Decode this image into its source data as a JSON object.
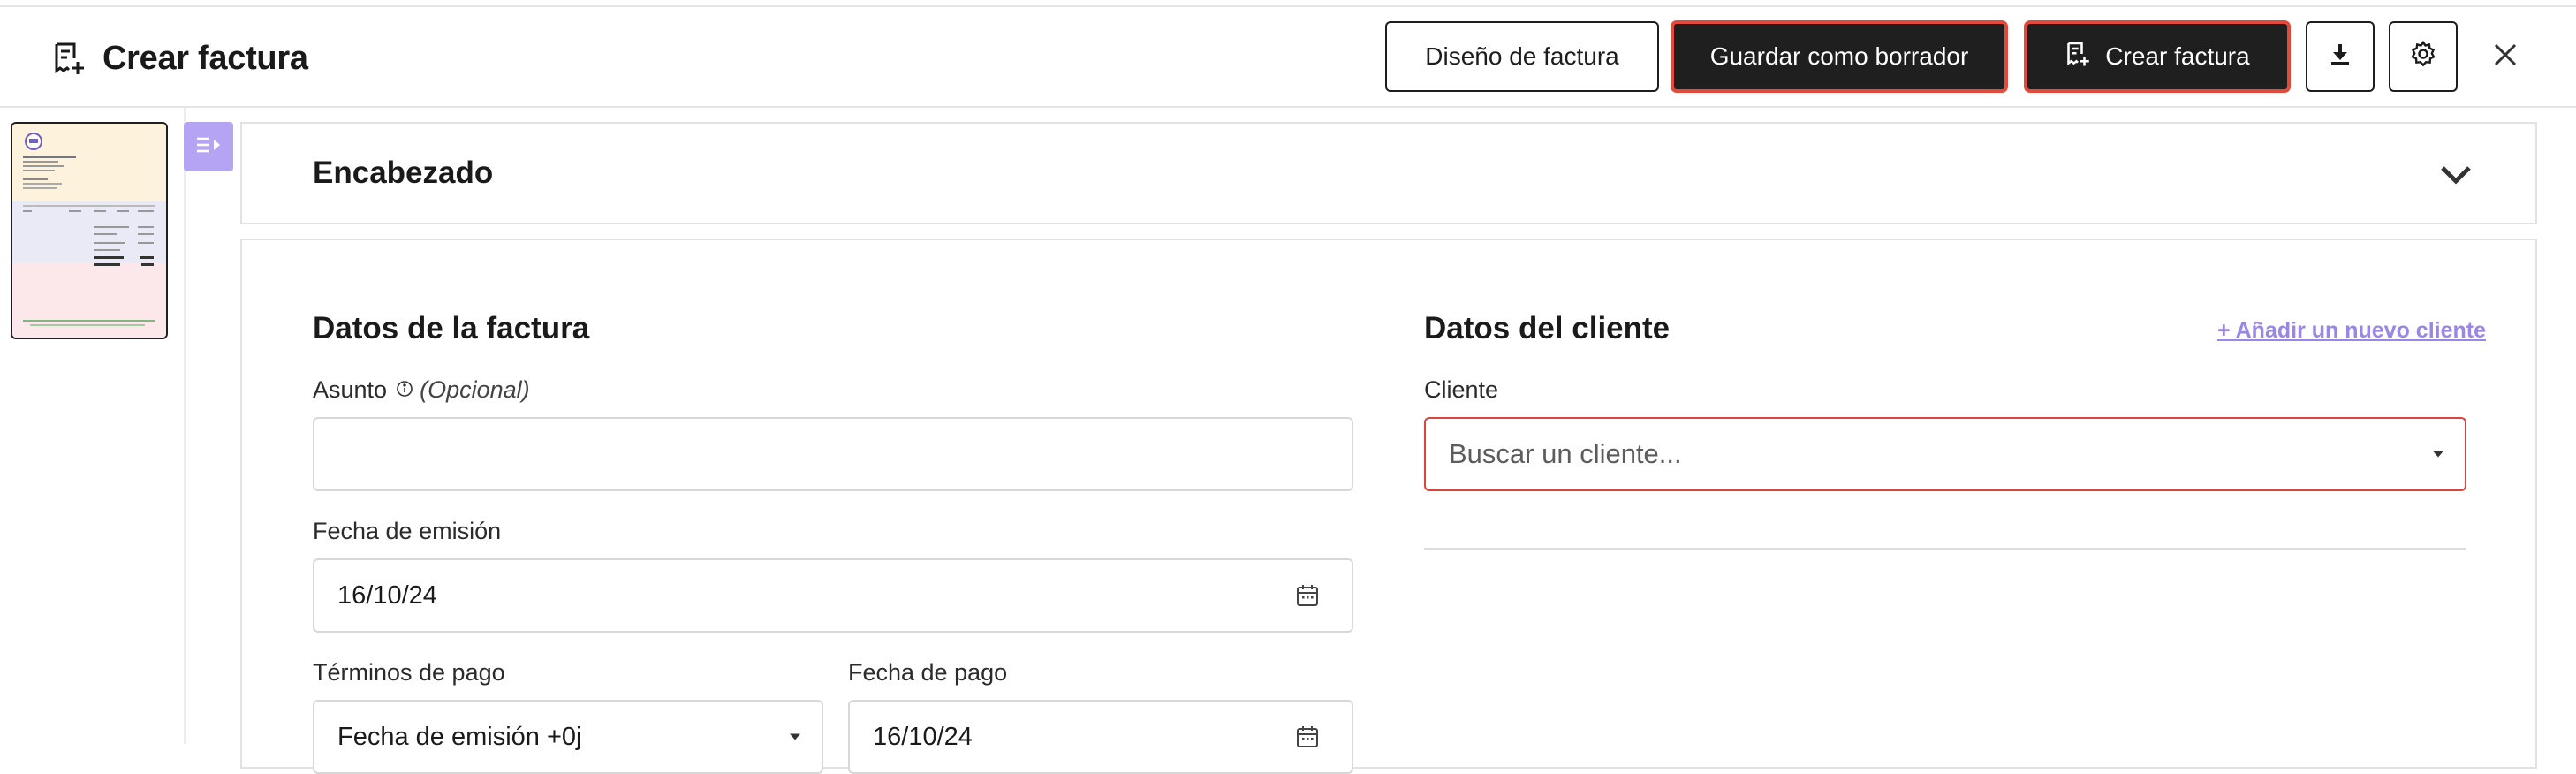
{
  "header": {
    "title": "Crear factura",
    "design_label": "Diseño de factura",
    "draft_label": "Guardar como borrador",
    "create_label": "Crear factura"
  },
  "sections": {
    "header_title": "Encabezado",
    "invoice_data_title": "Datos de la factura",
    "client_data_title": "Datos del cliente"
  },
  "invoice": {
    "subject_label": "Asunto",
    "subject_optional": "(Opcional)",
    "subject_value": "",
    "issue_date_label": "Fecha de emisión",
    "issue_date_value": "16/10/24",
    "payment_terms_label": "Términos de pago",
    "payment_terms_value": "Fecha de emisión +0j",
    "payment_date_label": "Fecha de pago",
    "payment_date_value": "16/10/24"
  },
  "client": {
    "add_client_link": "+ Añadir un nuevo cliente",
    "client_label": "Cliente",
    "client_placeholder": "Buscar un cliente..."
  },
  "colors": {
    "accent_purple": "#b5a4f4",
    "link_purple": "#9a86e6",
    "error_red": "#d9453a",
    "dark_button": "#1f1f1f"
  }
}
